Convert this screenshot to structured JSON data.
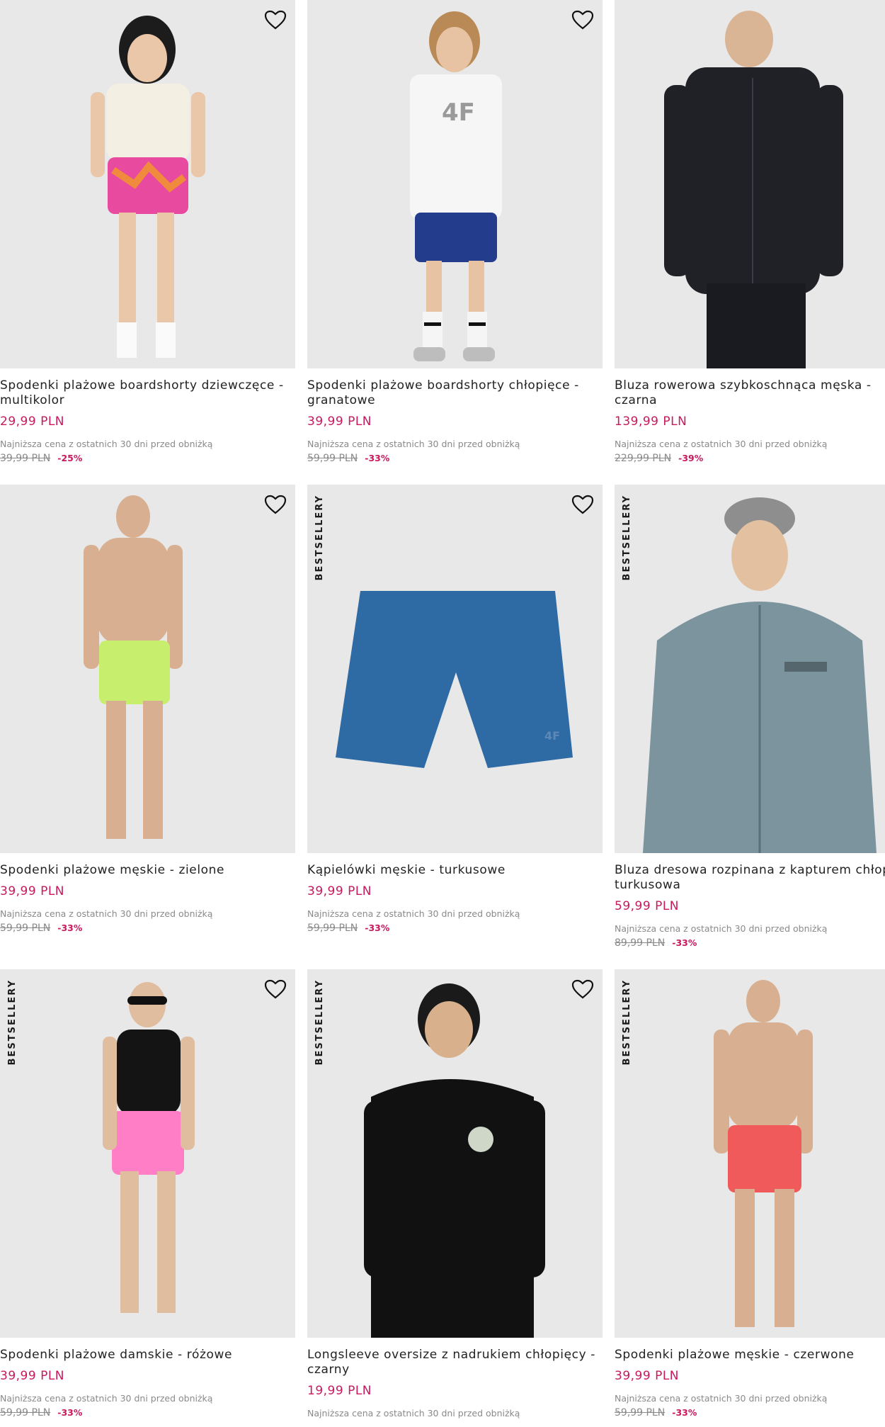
{
  "lowest_note": "Najniższa cena z ostatnich 30 dni przed obniżką",
  "badge_label": "BESTSELLERY",
  "products": [
    {
      "title": "Spodenki plażowe boardshorty dziewczęce - multikolor",
      "price": "29,99 PLN",
      "old_price": "39,99 PLN",
      "discount": "-25%"
    },
    {
      "title": "Spodenki plażowe boardshorty chłopięce - granatowe",
      "price": "39,99 PLN",
      "old_price": "59,99 PLN",
      "discount": "-33%"
    },
    {
      "title": "Bluza rowerowa szybkoschnąca męska - czarna",
      "price": "139,99 PLN",
      "old_price": "229,99 PLN",
      "discount": "-39%"
    },
    {
      "title": "Spodenki plażowe męskie - zielone",
      "price": "39,99 PLN",
      "old_price": "59,99 PLN",
      "discount": "-33%"
    },
    {
      "title": "Kąpielówki męskie - turkusowe",
      "price": "39,99 PLN",
      "old_price": "59,99 PLN",
      "discount": "-33%"
    },
    {
      "title": "Bluza dresowa rozpinana z kapturem chłopi - turkusowa",
      "price": "59,99 PLN",
      "old_price": "89,99 PLN",
      "discount": "-33%"
    },
    {
      "title": "Spodenki plażowe damskie - różowe",
      "price": "39,99 PLN",
      "old_price": "59,99 PLN",
      "discount": "-33%"
    },
    {
      "title": "Longsleeve oversize z nadrukiem chłopięcy - czarny",
      "price": "19,99 PLN",
      "old_price": "",
      "discount": ""
    },
    {
      "title": "Spodenki plażowe męskie - czerwone",
      "price": "39,99 PLN",
      "old_price": "59,99 PLN",
      "discount": "-33%"
    }
  ],
  "colors": {
    "price": "#c8195d",
    "card_bg": "#e8e8e8"
  }
}
